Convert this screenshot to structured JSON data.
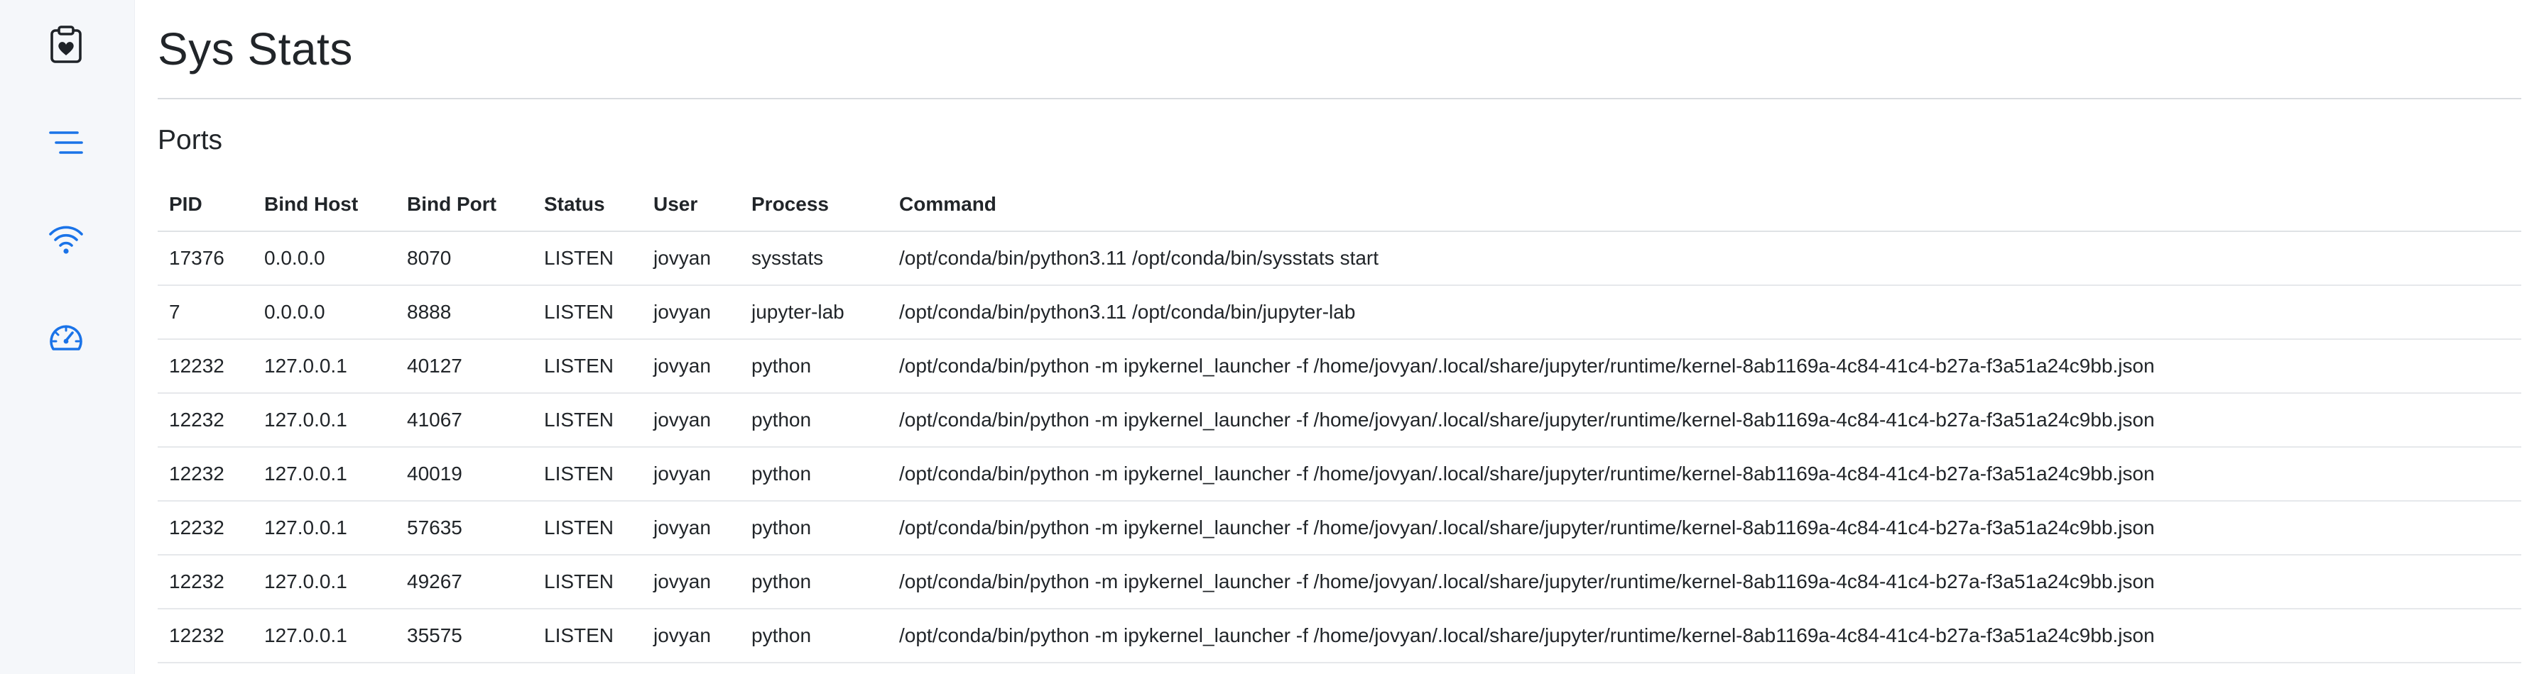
{
  "app": {
    "title": "Sys Stats"
  },
  "theme": {
    "accent": "#1a73e8",
    "dark_icon": "#1f2328",
    "sidebar_bg": "#f5f7fa"
  },
  "sidebar": {
    "items": [
      {
        "icon": "clipboard-heart-icon",
        "active": false
      },
      {
        "icon": "list-icon",
        "active": true
      },
      {
        "icon": "wifi-icon",
        "active": true
      },
      {
        "icon": "speedometer-icon",
        "active": true
      }
    ]
  },
  "ports": {
    "title": "Ports",
    "columns": [
      "PID",
      "Bind Host",
      "Bind Port",
      "Status",
      "User",
      "Process",
      "Command"
    ],
    "rows": [
      [
        "17376",
        "0.0.0.0",
        "8070",
        "LISTEN",
        "jovyan",
        "sysstats",
        "/opt/conda/bin/python3.11 /opt/conda/bin/sysstats start"
      ],
      [
        "7",
        "0.0.0.0",
        "8888",
        "LISTEN",
        "jovyan",
        "jupyter-lab",
        "/opt/conda/bin/python3.11 /opt/conda/bin/jupyter-lab"
      ],
      [
        "12232",
        "127.0.0.1",
        "40127",
        "LISTEN",
        "jovyan",
        "python",
        "/opt/conda/bin/python -m ipykernel_launcher -f /home/jovyan/.local/share/jupyter/runtime/kernel-8ab1169a-4c84-41c4-b27a-f3a51a24c9bb.json"
      ],
      [
        "12232",
        "127.0.0.1",
        "41067",
        "LISTEN",
        "jovyan",
        "python",
        "/opt/conda/bin/python -m ipykernel_launcher -f /home/jovyan/.local/share/jupyter/runtime/kernel-8ab1169a-4c84-41c4-b27a-f3a51a24c9bb.json"
      ],
      [
        "12232",
        "127.0.0.1",
        "40019",
        "LISTEN",
        "jovyan",
        "python",
        "/opt/conda/bin/python -m ipykernel_launcher -f /home/jovyan/.local/share/jupyter/runtime/kernel-8ab1169a-4c84-41c4-b27a-f3a51a24c9bb.json"
      ],
      [
        "12232",
        "127.0.0.1",
        "57635",
        "LISTEN",
        "jovyan",
        "python",
        "/opt/conda/bin/python -m ipykernel_launcher -f /home/jovyan/.local/share/jupyter/runtime/kernel-8ab1169a-4c84-41c4-b27a-f3a51a24c9bb.json"
      ],
      [
        "12232",
        "127.0.0.1",
        "49267",
        "LISTEN",
        "jovyan",
        "python",
        "/opt/conda/bin/python -m ipykernel_launcher -f /home/jovyan/.local/share/jupyter/runtime/kernel-8ab1169a-4c84-41c4-b27a-f3a51a24c9bb.json"
      ],
      [
        "12232",
        "127.0.0.1",
        "35575",
        "LISTEN",
        "jovyan",
        "python",
        "/opt/conda/bin/python -m ipykernel_launcher -f /home/jovyan/.local/share/jupyter/runtime/kernel-8ab1169a-4c84-41c4-b27a-f3a51a24c9bb.json"
      ]
    ]
  }
}
